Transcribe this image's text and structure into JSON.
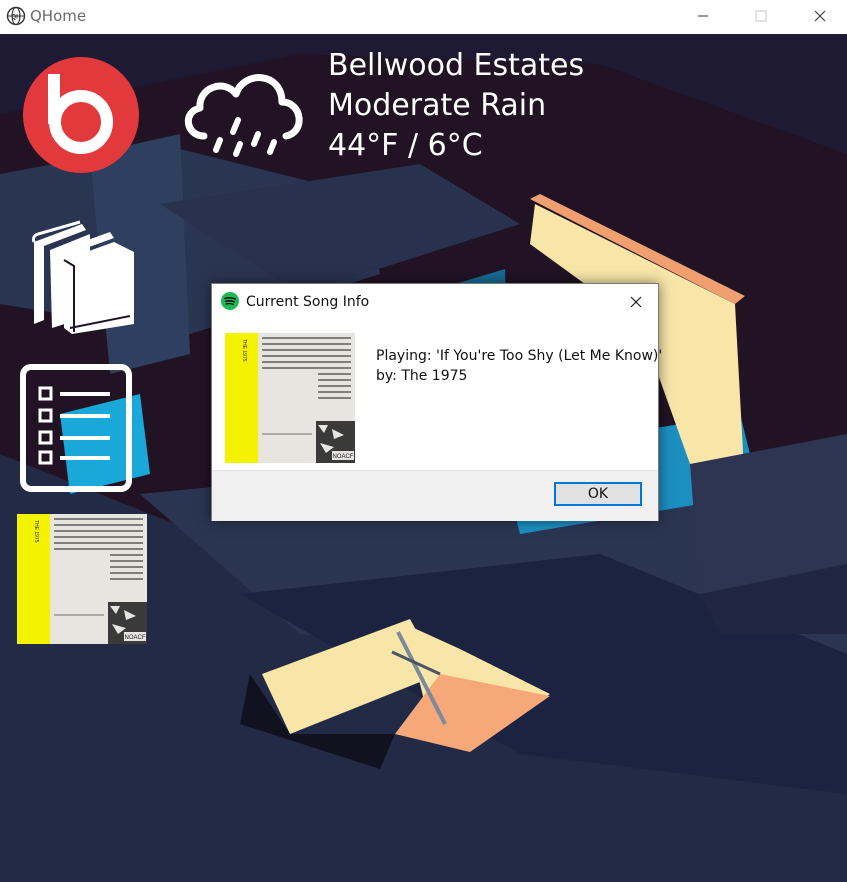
{
  "window": {
    "title": "QHome",
    "icon": "globe-icon",
    "controls": [
      "minimize-icon",
      "maximize-icon",
      "close-icon"
    ]
  },
  "weather": {
    "location": "Bellwood Estates",
    "condition": "Moderate Rain",
    "temperature": "44°F / 6°C",
    "icon": "rain-cloud-icon"
  },
  "sidebar": {
    "items": [
      {
        "name": "beats-logo",
        "icon": "beats-icon"
      },
      {
        "name": "books",
        "icon": "books-icon"
      },
      {
        "name": "checklist",
        "icon": "checklist-icon"
      },
      {
        "name": "album-art",
        "icon": "album-cover"
      }
    ]
  },
  "dialog": {
    "title": "Current Song Info",
    "icon": "spotify-icon",
    "playing_line": "Playing: 'If You're Too Shy (Let Me Know)'",
    "artist_line": "by: The 1975",
    "ok_label": "OK"
  },
  "album": {
    "spine_text": "THE 1975",
    "footer_text": "NOACF"
  },
  "colors": {
    "background": "#211324",
    "beats_red": "#e23a3c",
    "album_yellow": "#f5f200",
    "spotify_green": "#1db954",
    "ok_border": "#0078d7"
  }
}
